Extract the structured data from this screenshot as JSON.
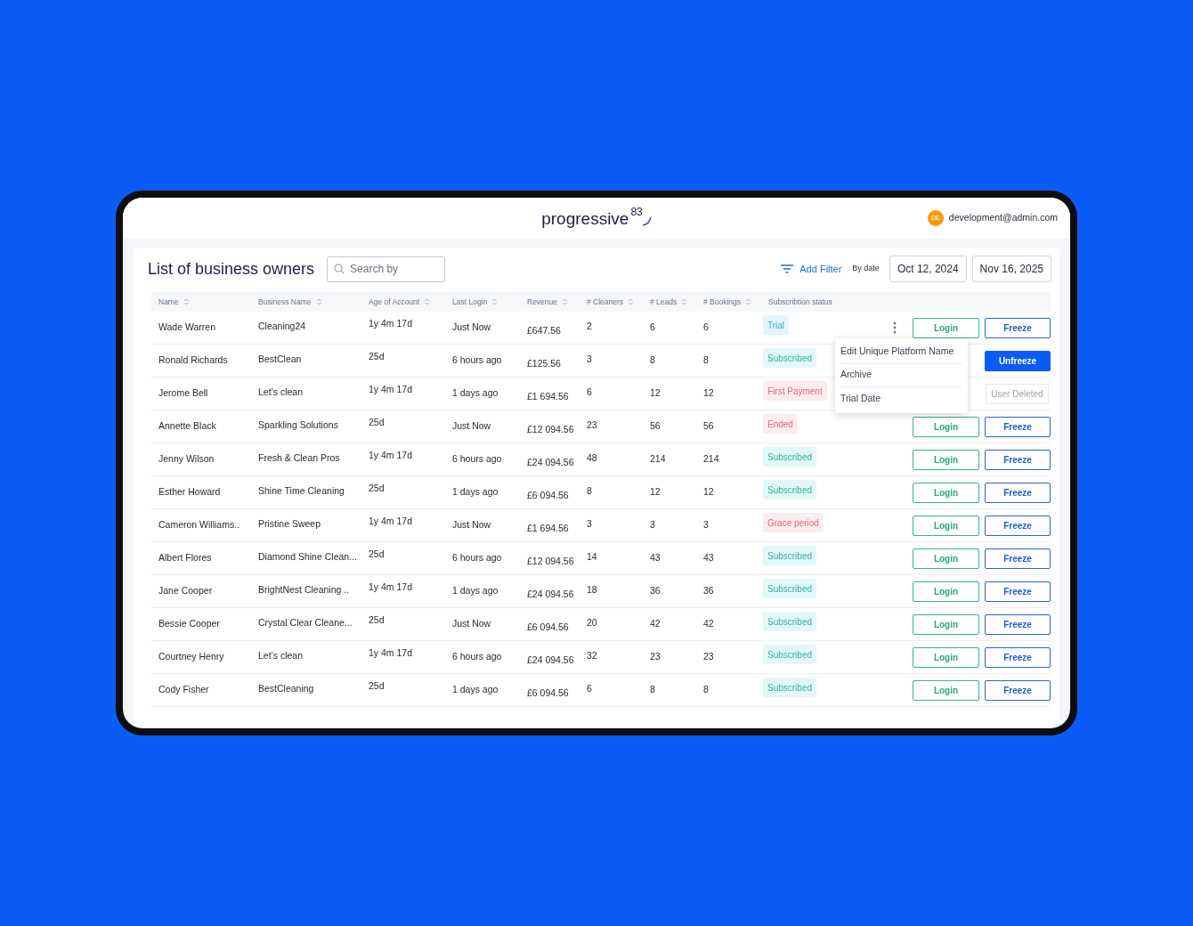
{
  "header": {
    "logo": {
      "word": "progressive",
      "mark": "83"
    },
    "user": {
      "initials": "DE",
      "email": "development@admin.com"
    }
  },
  "page": {
    "title": "List of business owners",
    "search": {
      "placeholder": "Search by"
    },
    "add_filter": "Add Filter",
    "date_label": "By date",
    "date_from": "Oct 12, 2024",
    "date_to": "Nov 16, 2025"
  },
  "table": {
    "columns": [
      {
        "label": "Name",
        "sortable": true
      },
      {
        "label": "Business Name",
        "sortable": true
      },
      {
        "label": "Age of Account",
        "sortable": true
      },
      {
        "label": "Last Login",
        "sortable": true
      },
      {
        "label": "Revenue",
        "sortable": true
      },
      {
        "label": "# Cleaners",
        "sortable": true
      },
      {
        "label": "# Leads",
        "sortable": true
      },
      {
        "label": "# Bookings",
        "sortable": true
      },
      {
        "label": "Subscribtion status",
        "sortable": false
      }
    ],
    "rows": [
      {
        "name": "Wade Warren",
        "business": "Cleaning24",
        "age": "1y 4m 17d",
        "last_login": "Just Now",
        "revenue": "£647.56",
        "cleaners": "2",
        "leads": "6",
        "bookings": "6",
        "status": {
          "label": "Trial",
          "kind": "trial"
        },
        "menu_button": true,
        "login": "Login",
        "action": {
          "label": "Freeze",
          "kind": "freeze"
        }
      },
      {
        "name": "Ronald Richards",
        "business": "BestClean",
        "age": "25d",
        "last_login": "6 hours ago",
        "revenue": "£125.56",
        "cleaners": "3",
        "leads": "8",
        "bookings": "8",
        "status": {
          "label": "Subscribed",
          "kind": "subscribed"
        },
        "menu_button": false,
        "action": {
          "label": "Unfreeze",
          "kind": "unfreeze"
        }
      },
      {
        "name": "Jerome Bell",
        "business": "Let’s clean",
        "age": "1y 4m 17d",
        "last_login": "1 days ago",
        "revenue": "£1 694.56",
        "cleaners": "6",
        "leads": "12",
        "bookings": "12",
        "status": {
          "label": "First Payment",
          "kind": "alert"
        },
        "menu_button": false,
        "action": {
          "label": "User Deleted",
          "kind": "deleted"
        }
      },
      {
        "name": "Annette Black",
        "business": "Sparkling Solutions",
        "age": "25d",
        "last_login": "Just Now",
        "revenue": "£12 094.56",
        "cleaners": "23",
        "leads": "56",
        "bookings": "56",
        "status": {
          "label": "Ended",
          "kind": "alert"
        },
        "menu_button": false,
        "login": "Login",
        "action": {
          "label": "Freeze",
          "kind": "freeze"
        }
      },
      {
        "name": "Jenny Wilson",
        "business": "Fresh & Clean Pros",
        "age": "1y 4m 17d",
        "last_login": "6 hours ago",
        "revenue": "£24 094.56",
        "cleaners": "48",
        "leads": "214",
        "bookings": "214",
        "status": {
          "label": "Subscribed",
          "kind": "subscribed"
        },
        "menu_button": false,
        "login": "Login",
        "action": {
          "label": "Freeze",
          "kind": "freeze"
        }
      },
      {
        "name": "Esther Howard",
        "business": "Shine Time Cleaning",
        "age": "25d",
        "last_login": "1 days ago",
        "revenue": "£6 094.56",
        "cleaners": "8",
        "leads": "12",
        "bookings": "12",
        "status": {
          "label": "Subscribed",
          "kind": "subscribed"
        },
        "menu_button": false,
        "login": "Login",
        "action": {
          "label": "Freeze",
          "kind": "freeze"
        }
      },
      {
        "name": "Cameron Williams..",
        "business": "Pristine Sweep",
        "age": "1y 4m 17d",
        "last_login": "Just Now",
        "revenue": "£1 694.56",
        "cleaners": "3",
        "leads": "3",
        "bookings": "3",
        "status": {
          "label": "Grace period",
          "kind": "alert"
        },
        "menu_button": false,
        "login": "Login",
        "action": {
          "label": "Freeze",
          "kind": "freeze"
        }
      },
      {
        "name": "Albert Flores",
        "business": "Diamond Shine Clean...",
        "age": "25d",
        "last_login": "6 hours ago",
        "revenue": "£12 094.56",
        "cleaners": "14",
        "leads": "43",
        "bookings": "43",
        "status": {
          "label": "Subscribed",
          "kind": "subscribed"
        },
        "menu_button": false,
        "login": "Login",
        "action": {
          "label": "Freeze",
          "kind": "freeze"
        }
      },
      {
        "name": "Jane Cooper",
        "business": "BrightNest Cleaning ..",
        "age": "1y 4m 17d",
        "last_login": "1 days ago",
        "revenue": "£24 094.56",
        "cleaners": "18",
        "leads": "36",
        "bookings": "36",
        "status": {
          "label": "Subscribed",
          "kind": "subscribed"
        },
        "menu_button": false,
        "login": "Login",
        "action": {
          "label": "Freeze",
          "kind": "freeze"
        }
      },
      {
        "name": "Bessie Cooper",
        "business": "Crystal Clear Cleane...",
        "age": "25d",
        "last_login": "Just Now",
        "revenue": "£6 094.56",
        "cleaners": "20",
        "leads": "42",
        "bookings": "42",
        "status": {
          "label": "Subscribed",
          "kind": "subscribed"
        },
        "menu_button": false,
        "login": "Login",
        "action": {
          "label": "Freeze",
          "kind": "freeze"
        }
      },
      {
        "name": "Courtney Henry",
        "business": "Let’s clean",
        "age": "1y 4m 17d",
        "last_login": "6 hours ago",
        "revenue": "£24 094.56",
        "cleaners": "32",
        "leads": "23",
        "bookings": "23",
        "status": {
          "label": "Subscribed",
          "kind": "subscribed"
        },
        "menu_button": false,
        "login": "Login",
        "action": {
          "label": "Freeze",
          "kind": "freeze"
        }
      },
      {
        "name": "Cody Fisher",
        "business": "BestCleaning",
        "age": "25d",
        "last_login": "1 days ago",
        "revenue": "£6 094.56",
        "cleaners": "6",
        "leads": "8",
        "bookings": "8",
        "status": {
          "label": "Subscribed",
          "kind": "subscribed"
        },
        "menu_button": false,
        "login": "Login",
        "action": {
          "label": "Freeze",
          "kind": "freeze"
        }
      }
    ]
  },
  "context_menu": {
    "items": [
      "Edit Unique Platform Name",
      "Archive",
      "Trial Date"
    ]
  }
}
